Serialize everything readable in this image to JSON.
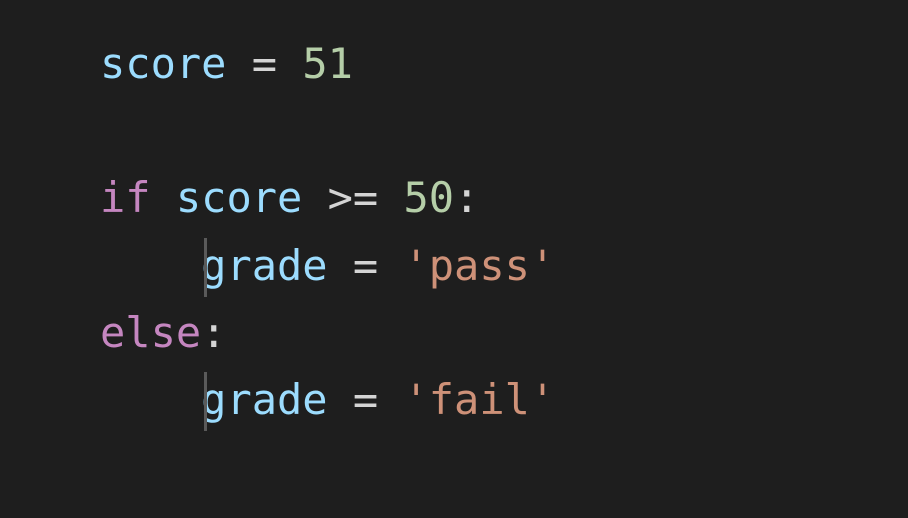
{
  "code": {
    "line1": {
      "var": "score",
      "op": "=",
      "num": "51"
    },
    "line3": {
      "kw": "if",
      "var": "score",
      "op": ">=",
      "num": "50",
      "colon": ":"
    },
    "line4": {
      "var": "grade",
      "op": "=",
      "str": "'pass'"
    },
    "line5": {
      "kw": "else",
      "colon": ":"
    },
    "line6": {
      "var": "grade",
      "op": "=",
      "str": "'fail'"
    }
  }
}
